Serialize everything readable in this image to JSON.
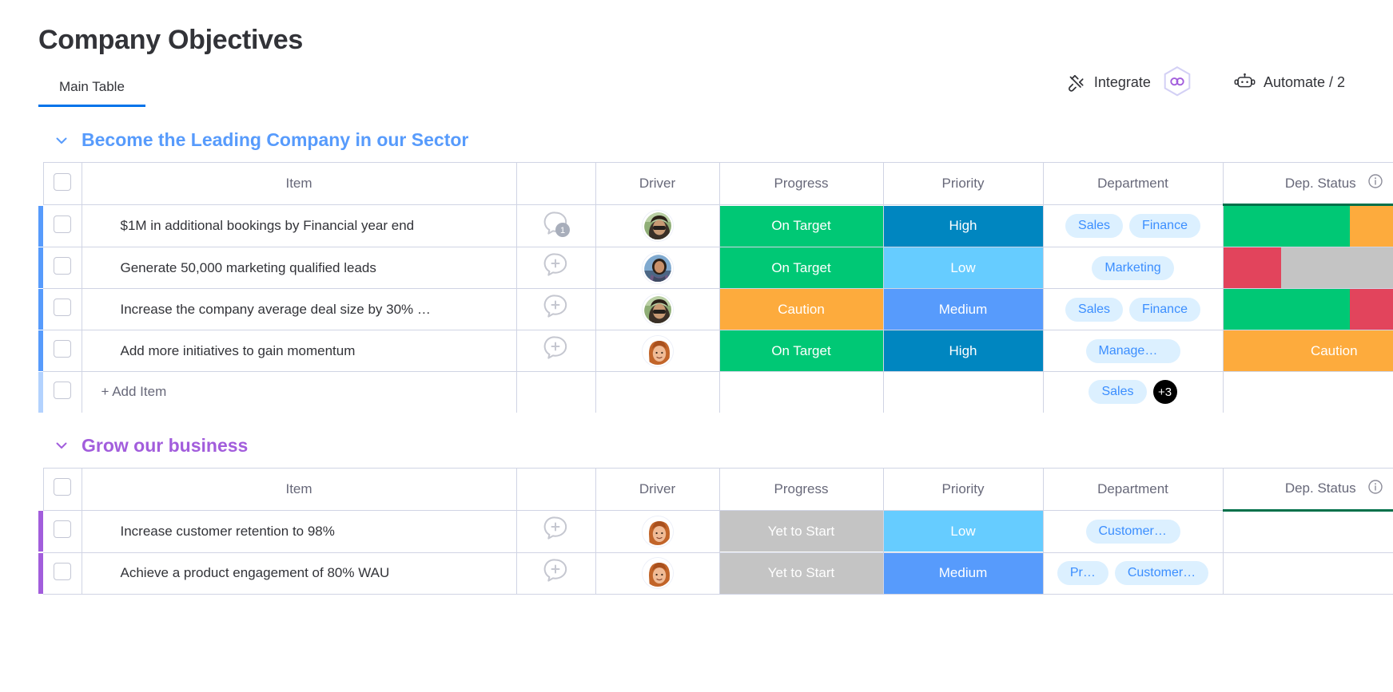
{
  "board": {
    "title": "Company Objectives",
    "tabs": [
      {
        "label": "Main Table",
        "active": true
      }
    ],
    "actions": {
      "integrate_label": "Integrate",
      "automate_label": "Automate / 2"
    }
  },
  "colors": {
    "accent_blue": "#0073ea",
    "group_blue": "#579bfc",
    "group_purple": "#a25ddc",
    "tag_bg": "#dcf0ff",
    "tag_text": "#3b8eff",
    "green": "#00c875",
    "orange": "#fdab3d",
    "red": "#e2445c",
    "grey": "#c4c4c4",
    "high_blue": "#0086c0",
    "medium_blue": "#579bfc",
    "low_blue": "#66ccff",
    "status_underline": "#00704a"
  },
  "columns": [
    "Item",
    "Driver",
    "Progress",
    "Priority",
    "Department",
    "Dep. Status"
  ],
  "add_item_label": "+ Add Item",
  "groups": [
    {
      "title": "Become the Leading Company in our Sector",
      "color": "#579bfc",
      "collapsed": false,
      "rows": [
        {
          "item": "$1M in additional bookings by Financial year end",
          "chat": "1",
          "driver": "avatar-sunglasses",
          "progress": {
            "label": "On Target",
            "color": "#00c875"
          },
          "priority": {
            "label": "High",
            "color": "#0086c0"
          },
          "departments": [
            "Sales",
            "Finance"
          ],
          "dep_status": {
            "type": "battery",
            "segments": [
              {
                "color": "#00c875",
                "pct": 57
              },
              {
                "color": "#fdab3d",
                "pct": 43
              }
            ]
          }
        },
        {
          "item": "Generate 50,000 marketing qualified leads",
          "chat": "",
          "driver": "avatar-scarf",
          "progress": {
            "label": "On Target",
            "color": "#00c875"
          },
          "priority": {
            "label": "Low",
            "color": "#66ccff"
          },
          "departments": [
            "Marketing"
          ],
          "dep_status": {
            "type": "battery",
            "segments": [
              {
                "color": "#e2445c",
                "pct": 26
              },
              {
                "color": "#c4c4c4",
                "pct": 74
              }
            ]
          }
        },
        {
          "item": "Increase the company average deal size by 30% …",
          "chat": "",
          "driver": "avatar-sunglasses",
          "progress": {
            "label": "Caution",
            "color": "#fdab3d"
          },
          "priority": {
            "label": "Medium",
            "color": "#579bfc"
          },
          "departments": [
            "Sales",
            "Finance"
          ],
          "dep_status": {
            "type": "battery",
            "segments": [
              {
                "color": "#00c875",
                "pct": 57
              },
              {
                "color": "#e2445c",
                "pct": 43
              }
            ]
          }
        },
        {
          "item": "Add more initiatives to gain momentum",
          "chat": "",
          "driver": "avatar-redhair",
          "progress": {
            "label": "On Target",
            "color": "#00c875"
          },
          "priority": {
            "label": "High",
            "color": "#0086c0"
          },
          "departments": [
            "Management"
          ],
          "dep_status": {
            "type": "label",
            "label": "Caution",
            "color": "#fdab3d"
          }
        }
      ],
      "add_row": {
        "departments": [
          "Sales"
        ],
        "more": "+3"
      }
    },
    {
      "title": "Grow our business",
      "color": "#a25ddc",
      "collapsed": false,
      "rows": [
        {
          "item": "Increase customer retention to 98%",
          "chat": "",
          "driver": "avatar-redhair",
          "progress": {
            "label": "Yet to Start",
            "color": "#c4c4c4"
          },
          "priority": {
            "label": "Low",
            "color": "#66ccff"
          },
          "departments": [
            "Customer Success"
          ],
          "dep_status": {
            "type": "empty"
          }
        },
        {
          "item": "Achieve a product engagement of 80% WAU",
          "chat": "",
          "driver": "avatar-redhair",
          "progress": {
            "label": "Yet to Start",
            "color": "#c4c4c4"
          },
          "priority": {
            "label": "Medium",
            "color": "#579bfc"
          },
          "departments": [
            "Pr…",
            "Customer…"
          ],
          "dep_status": {
            "type": "empty"
          }
        }
      ],
      "add_row": null
    }
  ]
}
